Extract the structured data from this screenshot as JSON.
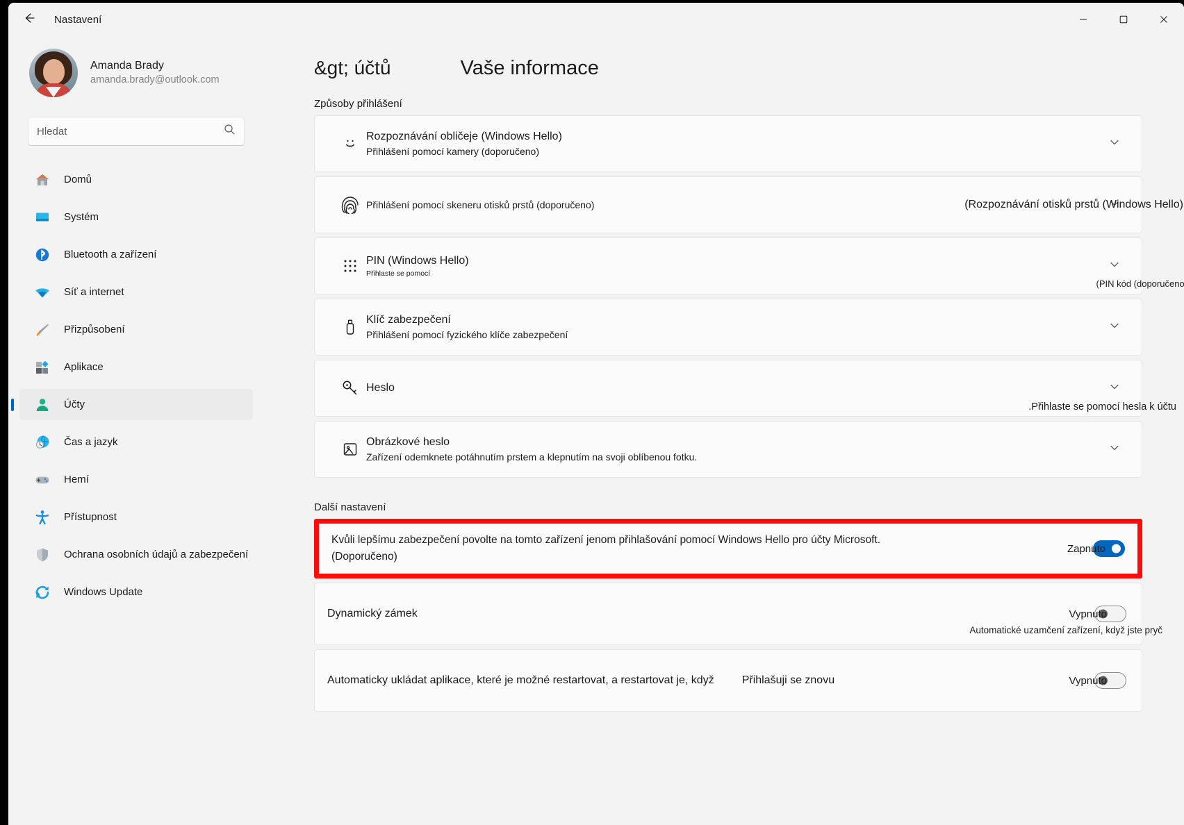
{
  "window": {
    "title": "Nastavení",
    "back_icon": "back-arrow-icon",
    "minimize_icon": "minimize-icon",
    "maximize_icon": "maximize-icon",
    "close_icon": "close-icon"
  },
  "sidebar": {
    "profile": {
      "name": "Amanda Brady",
      "email": "amanda.brady@outlook.com"
    },
    "search": {
      "placeholder": "Hledat",
      "value": "",
      "icon": "search-icon"
    },
    "items": [
      {
        "label": "Domů",
        "icon": "home-icon",
        "active": false
      },
      {
        "label": "Systém",
        "icon": "system-icon",
        "active": false
      },
      {
        "label": "Bluetooth a zařízení",
        "icon": "bluetooth-icon",
        "active": false
      },
      {
        "label": "Síť a internet",
        "icon": "network-icon",
        "active": false
      },
      {
        "label": "Přizpůsobení",
        "icon": "personalization-icon",
        "active": false
      },
      {
        "label": "Aplikace",
        "icon": "apps-icon",
        "active": false
      },
      {
        "label": "Účty",
        "icon": "accounts-icon",
        "active": true
      },
      {
        "label": "Čas a jazyk",
        "icon": "time-language-icon",
        "active": false
      },
      {
        "label": "Hemí",
        "icon": "gaming-icon",
        "active": false
      },
      {
        "label": "Přístupnost",
        "icon": "accessibility-icon",
        "active": false
      },
      {
        "label": "Ochrana osobních údajů a zabezpečení",
        "icon": "privacy-shield-icon",
        "active": false
      },
      {
        "label": "Windows Update",
        "icon": "windows-update-icon",
        "active": false
      }
    ]
  },
  "main": {
    "breadcrumb": "&gt; účtů",
    "title": "Vaše informace",
    "signin_section_label": "Způsoby přihlášení",
    "signin_methods": [
      {
        "title": "Rozpoznávání obličeje (Windows Hello)",
        "subtitle": "Přihlášení pomocí kamery (doporučeno)",
        "icon": "face-recognition-icon",
        "chevron": "chevron-down-icon",
        "overflow_text": ""
      },
      {
        "title": "",
        "subtitle": "Přihlášení pomocí skeneru otisků prstů (doporučeno)",
        "icon": "fingerprint-icon",
        "chevron": "chevron-down-icon",
        "overflow_text": "(Rozpoznávání otisků prstů (Windows Hello)"
      },
      {
        "title": "PIN (Windows Hello)",
        "subtitle": "Přihlaste se pomocí",
        "icon": "pin-keypad-icon",
        "chevron": "chevron-down-icon",
        "overflow_text": "(PIN kód (doporučeno)"
      },
      {
        "title": "Klíč zabezpečení",
        "subtitle": "Přihlášení pomocí fyzického klíče zabezpečení",
        "icon": "security-key-icon",
        "chevron": "chevron-down-icon",
        "overflow_text": ""
      },
      {
        "title": "Heslo",
        "subtitle": "",
        "icon": "password-key-icon",
        "chevron": "chevron-down-icon",
        "overflow_text": ".Přihlaste se pomocí hesla k účtu"
      },
      {
        "title": "Obrázkové heslo",
        "subtitle": "Zařízení odemknete potáhnutím prstem a klepnutím na svoji oblíbenou fotku.",
        "icon": "picture-password-icon",
        "chevron": "chevron-down-icon",
        "overflow_text": ""
      }
    ],
    "other_section_label": "Další nastavení",
    "highlighted_setting": {
      "line1": "Kvůli lepšímu zabezpečení povolte na tomto zařízení jenom přihlašování pomocí Windows Hello pro účty Microsoft.",
      "line2": "(Doporučeno)",
      "toggle_label": "Zapnuto",
      "toggle_state": "on",
      "highlight_color": "#fc0d09"
    },
    "settings_rows": [
      {
        "title": "Dynamický zámek",
        "mid": "",
        "toggle_label": "Vypnuto",
        "toggle_state": "off",
        "sub": "Automatické uzamčení zařízení, když jste pryč"
      },
      {
        "title": "Automaticky ukládat aplikace, které je možné restartovat, a restartovat je, když",
        "mid": "Přihlašuji se znovu",
        "toggle_label": "Vypnuto",
        "toggle_state": "off",
        "sub": ""
      }
    ]
  }
}
